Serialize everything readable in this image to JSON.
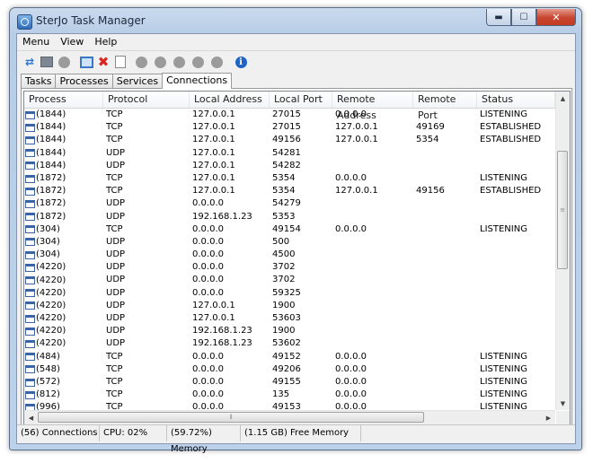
{
  "window": {
    "title": "SterJo Task Manager",
    "buttons": {
      "minimize": "▬",
      "maximize": "☐",
      "close": "✕"
    }
  },
  "menu": [
    "Menu",
    "View",
    "Help"
  ],
  "toolbar_icons": [
    "refresh-icon",
    "windows-icon",
    "block-icon",
    "window-icon",
    "end-process-icon",
    "document-icon",
    "disabled-icon",
    "disabled-icon",
    "disabled-icon",
    "disabled-icon",
    "disabled-icon",
    "info-icon"
  ],
  "tabs": [
    {
      "label": "Tasks",
      "active": false
    },
    {
      "label": "Processes",
      "active": false
    },
    {
      "label": "Services",
      "active": false
    },
    {
      "label": "Connections",
      "active": true
    }
  ],
  "columns": [
    "Process",
    "Protocol",
    "Local Address",
    "Local Port",
    "Remote Address",
    "Remote Port",
    "Status"
  ],
  "rows": [
    [
      "(1844)",
      "TCP",
      "127.0.0.1",
      "27015",
      "0.0.0.0",
      "",
      "LISTENING"
    ],
    [
      "(1844)",
      "TCP",
      "127.0.0.1",
      "27015",
      "127.0.0.1",
      "49169",
      "ESTABLISHED"
    ],
    [
      "(1844)",
      "TCP",
      "127.0.0.1",
      "49156",
      "127.0.0.1",
      "5354",
      "ESTABLISHED"
    ],
    [
      "(1844)",
      "UDP",
      "127.0.0.1",
      "54281",
      "",
      "",
      ""
    ],
    [
      "(1844)",
      "UDP",
      "127.0.0.1",
      "54282",
      "",
      "",
      ""
    ],
    [
      "(1872)",
      "TCP",
      "127.0.0.1",
      "5354",
      "0.0.0.0",
      "",
      "LISTENING"
    ],
    [
      "(1872)",
      "TCP",
      "127.0.0.1",
      "5354",
      "127.0.0.1",
      "49156",
      "ESTABLISHED"
    ],
    [
      "(1872)",
      "UDP",
      "0.0.0.0",
      "54279",
      "",
      "",
      ""
    ],
    [
      "(1872)",
      "UDP",
      "192.168.1.23",
      "5353",
      "",
      "",
      ""
    ],
    [
      "(304)",
      "TCP",
      "0.0.0.0",
      "49154",
      "0.0.0.0",
      "",
      "LISTENING"
    ],
    [
      "(304)",
      "UDP",
      "0.0.0.0",
      "500",
      "",
      "",
      ""
    ],
    [
      "(304)",
      "UDP",
      "0.0.0.0",
      "4500",
      "",
      "",
      ""
    ],
    [
      "(4220)",
      "UDP",
      "0.0.0.0",
      "3702",
      "",
      "",
      ""
    ],
    [
      "(4220)",
      "UDP",
      "0.0.0.0",
      "3702",
      "",
      "",
      ""
    ],
    [
      "(4220)",
      "UDP",
      "0.0.0.0",
      "59325",
      "",
      "",
      ""
    ],
    [
      "(4220)",
      "UDP",
      "127.0.0.1",
      "1900",
      "",
      "",
      ""
    ],
    [
      "(4220)",
      "UDP",
      "127.0.0.1",
      "53603",
      "",
      "",
      ""
    ],
    [
      "(4220)",
      "UDP",
      "192.168.1.23",
      "1900",
      "",
      "",
      ""
    ],
    [
      "(4220)",
      "UDP",
      "192.168.1.23",
      "53602",
      "",
      "",
      ""
    ],
    [
      "(484)",
      "TCP",
      "0.0.0.0",
      "49152",
      "0.0.0.0",
      "",
      "LISTENING"
    ],
    [
      "(548)",
      "TCP",
      "0.0.0.0",
      "49206",
      "0.0.0.0",
      "",
      "LISTENING"
    ],
    [
      "(572)",
      "TCP",
      "0.0.0.0",
      "49155",
      "0.0.0.0",
      "",
      "LISTENING"
    ],
    [
      "(812)",
      "TCP",
      "0.0.0.0",
      "135",
      "0.0.0.0",
      "",
      "LISTENING"
    ],
    [
      "(996)",
      "TCP",
      "0.0.0.0",
      "49153",
      "0.0.0.0",
      "",
      "LISTENING"
    ]
  ],
  "status": {
    "connections": "(56) Connections",
    "cpu": "CPU: 02%",
    "memory": "(59.72%) Memory",
    "free_memory": "(1.15 GB) Free Memory"
  },
  "colors": {
    "titlebar": "#c9daee",
    "close_button": "#c6452f",
    "process_icon": "#3a63a8"
  }
}
